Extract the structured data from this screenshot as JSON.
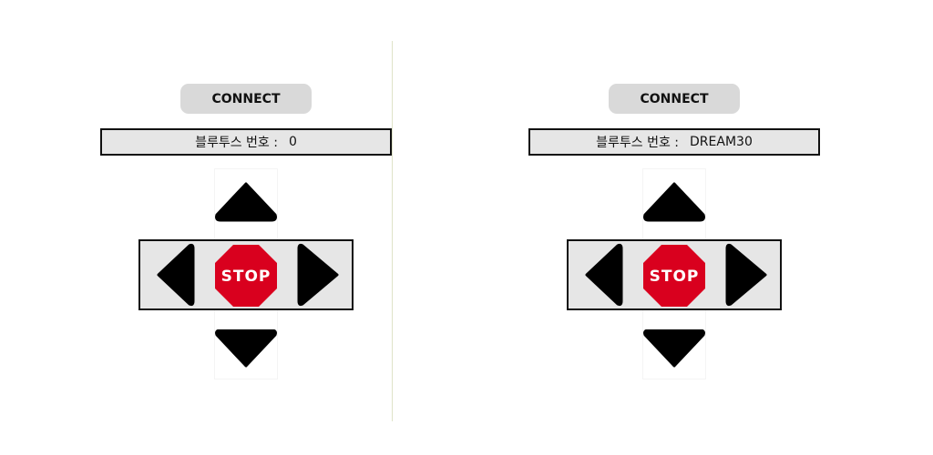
{
  "panels": [
    {
      "connect_label": "CONNECT",
      "bt_label": "블루투스 번호 :",
      "bt_value": "0",
      "stop_label": "STOP"
    },
    {
      "connect_label": "CONNECT",
      "bt_label": "블루투스 번호 :",
      "bt_value": "DREAM30",
      "stop_label": "STOP"
    }
  ],
  "icons": {
    "up": "triangle-up-icon",
    "down": "triangle-down-icon",
    "left": "triangle-left-icon",
    "right": "triangle-right-icon",
    "stop": "stop-sign-icon"
  },
  "colors": {
    "stop_red": "#d9001e",
    "button_gray": "#d9d9d9",
    "bar_gray": "#e6e6e6"
  }
}
